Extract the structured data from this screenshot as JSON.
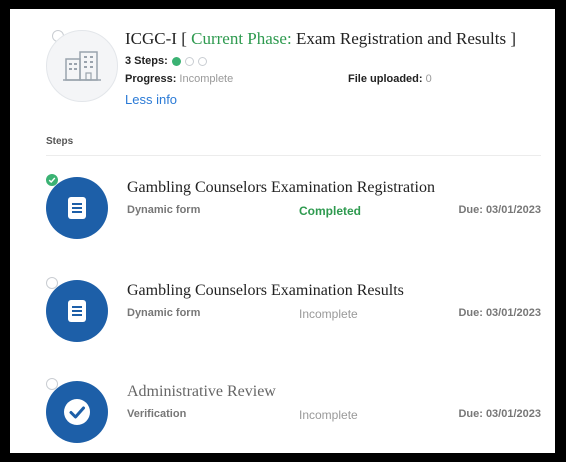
{
  "program": {
    "name": "ICGC-I",
    "bracket_open": "[",
    "phase_label": "Current Phase:",
    "phase_value": "Exam Registration and Results",
    "bracket_close": "]",
    "steps_label": "3 Steps:",
    "progress_label": "Progress:",
    "progress_value": "Incomplete",
    "file_label": "File uploaded:",
    "file_value": "0",
    "less_info": "Less info"
  },
  "steps_section_label": "Steps",
  "steps": [
    {
      "name": "Gambling Counselors Examination Registration",
      "type": "Dynamic form",
      "status": "Completed",
      "due": "Due: 03/01/2023",
      "icon": "document-icon"
    },
    {
      "name": "Gambling Counselors Examination Results",
      "type": "Dynamic form",
      "status": "Incomplete",
      "due": "Due: 03/01/2023",
      "icon": "document-icon"
    },
    {
      "name": "Administrative Review",
      "type": "Verification",
      "status": "Incomplete",
      "due": "Due: 03/01/2023",
      "icon": "checkmark-icon"
    }
  ],
  "colors": {
    "accent_blue": "#1d5fa8",
    "success_green": "#2e9a4f",
    "link_blue": "#2a7ad6"
  }
}
